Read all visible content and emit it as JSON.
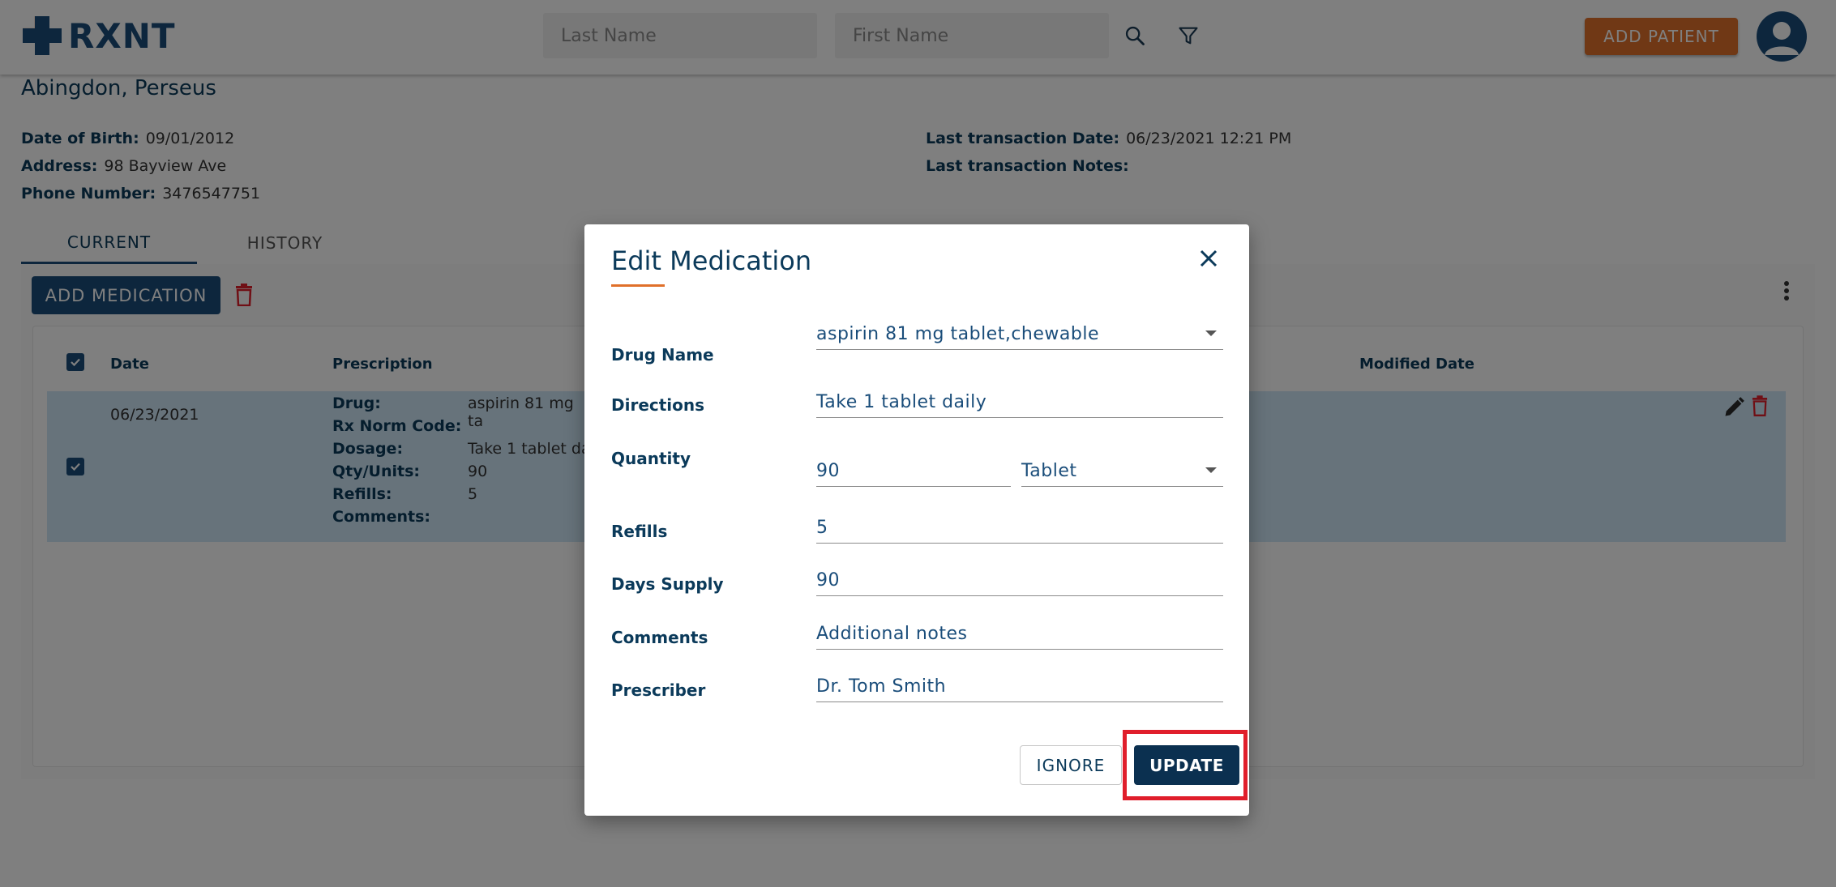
{
  "header": {
    "logo_text": "RXNT",
    "last_name_placeholder": "Last Name",
    "first_name_placeholder": "First Name",
    "add_patient_label": "ADD PATIENT"
  },
  "patient": {
    "name": "Abingdon, Perseus",
    "dob_label": "Date of Birth:",
    "dob": "09/01/2012",
    "address_label": "Address:",
    "address": "98 Bayview Ave",
    "phone_label": "Phone Number:",
    "phone": "3476547751",
    "last_txn_date_label": "Last transaction Date:",
    "last_txn_date": "06/23/2021 12:21 PM",
    "last_txn_notes_label": "Last transaction Notes:"
  },
  "tabs": [
    {
      "label": "CURRENT"
    },
    {
      "label": "HISTORY"
    }
  ],
  "toolbar": {
    "add_medication_label": "ADD MEDICATION"
  },
  "table": {
    "headers": {
      "date": "Date",
      "prescription": "Prescription",
      "modified_date": "Modified Date"
    },
    "row": {
      "date": "06/23/2021",
      "drug_label": "Drug:",
      "drug": "aspirin 81 mg ta",
      "rxnorm_label": "Rx Norm Code:",
      "dosage_label": "Dosage:",
      "dosage": "Take 1 tablet da",
      "qty_label": "Qty/Units:",
      "qty": "90",
      "refills_label": "Refills:",
      "refills": "5",
      "comments_label": "Comments:"
    }
  },
  "modal": {
    "title": "Edit Medication",
    "drug_name_label": "Drug Name",
    "drug_name": "aspirin 81 mg tablet,chewable",
    "directions_label": "Directions",
    "directions": "Take 1 tablet daily",
    "quantity_label": "Quantity",
    "quantity": "90",
    "unit": "Tablet",
    "refills_label": "Refills",
    "refills": "5",
    "days_supply_label": "Days Supply",
    "days_supply": "90",
    "comments_label": "Comments",
    "comments_placeholder": "Additional notes",
    "prescriber_label": "Prescriber",
    "prescriber": "Dr. Tom Smith",
    "ignore_label": "IGNORE",
    "update_label": "UPDATE"
  },
  "colors": {
    "brand_navy": "#1a4d7a",
    "brand_orange": "#e0702a",
    "row_highlight": "#cfe6f7",
    "delete_red": "#e01e2b",
    "callout_red": "#e01e2b"
  }
}
